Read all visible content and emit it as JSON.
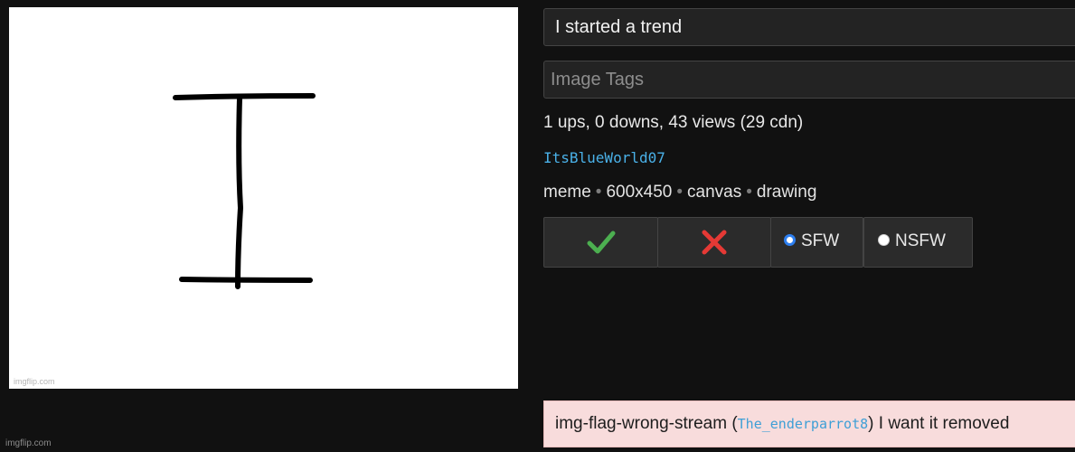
{
  "image": {
    "watermark": "imgflip.com"
  },
  "page_watermark": "imgflip.com",
  "form": {
    "title_value": "I started a trend",
    "tags_placeholder": "Image Tags"
  },
  "stats": "1 ups, 0 downs, 43 views (29 cdn)",
  "author": "ItsBlueWorld07",
  "meta": {
    "type": "meme",
    "dimensions": "600x450",
    "tag1": "canvas",
    "tag2": "drawing"
  },
  "actions": {
    "approve_icon": "check-icon",
    "reject_icon": "x-icon",
    "sfw_label": "SFW",
    "nsfw_label": "NSFW",
    "selected": "SFW"
  },
  "flag": {
    "reason": "img-flag-wrong-stream (",
    "user": "The_enderparrot8",
    "comment": ") I want it removed"
  },
  "colors": {
    "approve": "#4caf50",
    "reject": "#e53935",
    "link": "#4ab1e8",
    "flag_bg": "#f8dcdc"
  }
}
